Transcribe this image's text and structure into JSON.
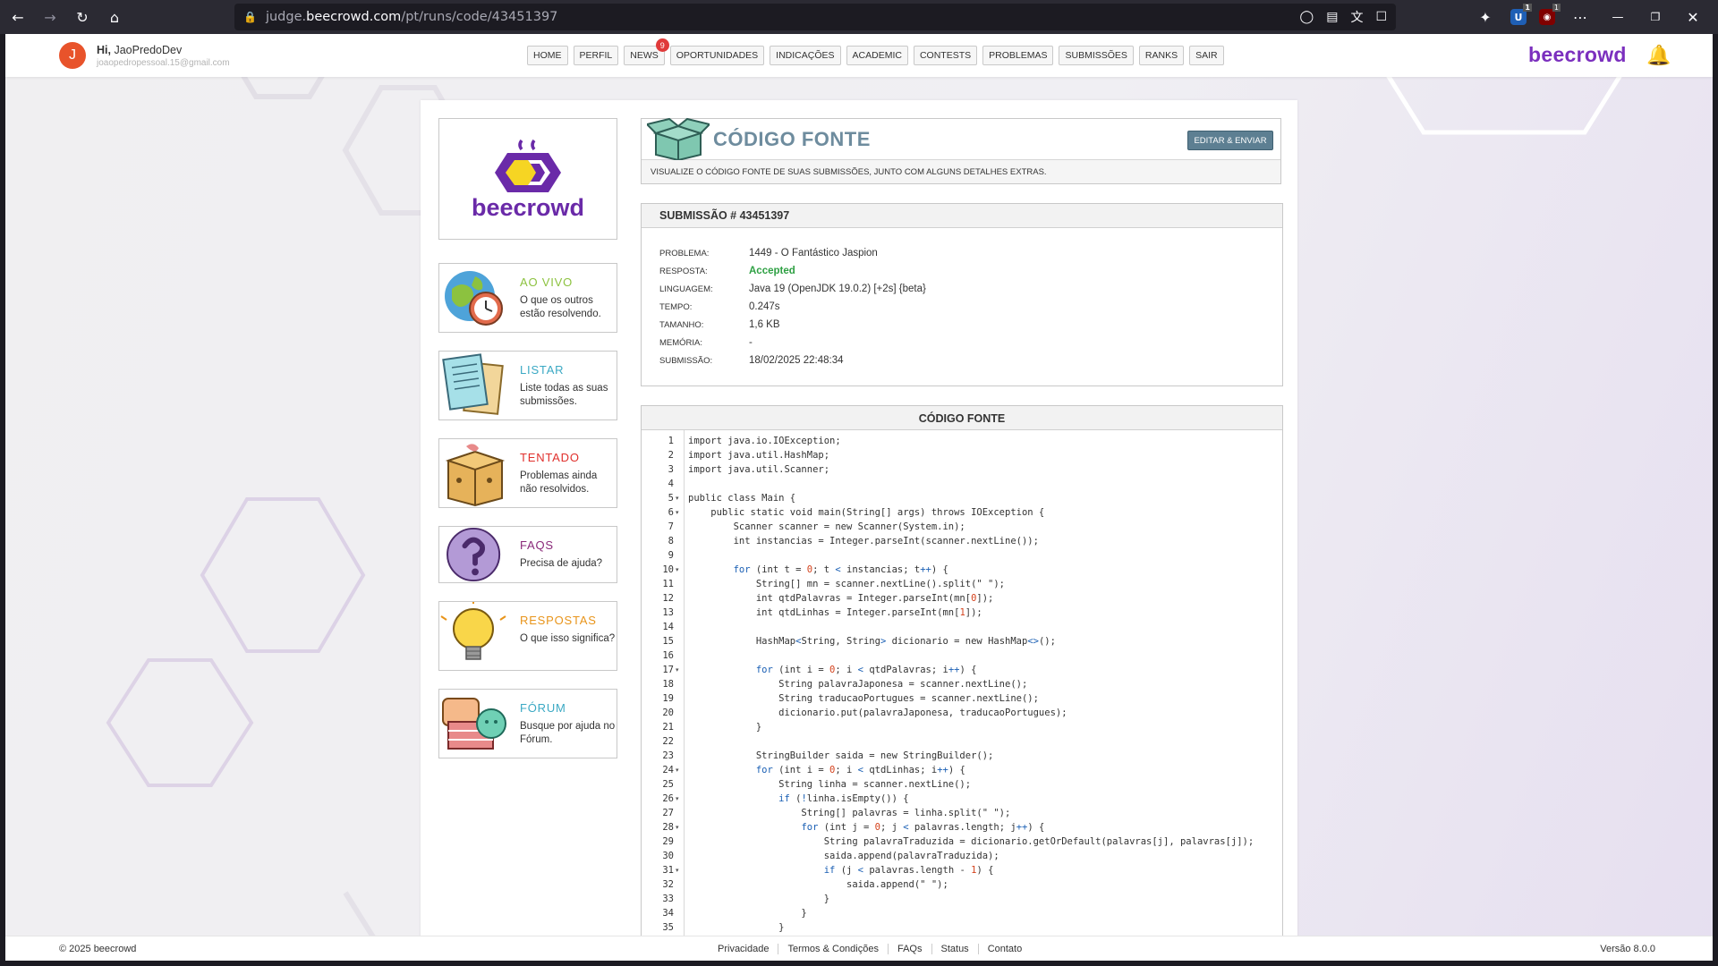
{
  "browser": {
    "url_prefix": "judge.",
    "url_domain": "beecrowd.com",
    "url_path": "/pt/runs/code/43451397",
    "ext_badge_1": "1",
    "ext_badge_2": "1"
  },
  "topbar": {
    "avatar_letter": "J",
    "greeting": "Hi,",
    "username": "JaoPredoDev",
    "email": "joaopedropessoal.15@gmail.com",
    "brand": "beecrowd",
    "menu": [
      {
        "label": "HOME"
      },
      {
        "label": "PERFIL"
      },
      {
        "label": "NEWS",
        "badge": "9"
      },
      {
        "label": "OPORTUNIDADES"
      },
      {
        "label": "INDICAÇÕES"
      },
      {
        "label": "ACADEMIC"
      },
      {
        "label": "CONTESTS"
      },
      {
        "label": "PROBLEMAS"
      },
      {
        "label": "SUBMISSÕES"
      },
      {
        "label": "RANKS"
      },
      {
        "label": "SAIR"
      }
    ]
  },
  "sidebar": {
    "logo_text": "beecrowd",
    "items": [
      {
        "title": "AO VIVO",
        "desc": "O que os outros estão resolvendo.",
        "color": "#8cc23f",
        "icon": "globe-clock-icon"
      },
      {
        "title": "LISTAR",
        "desc": "Liste todas as suas submissões.",
        "color": "#3ba9c4",
        "icon": "list-papers-icon"
      },
      {
        "title": "TENTADO",
        "desc": "Problemas ainda não resolvidos.",
        "color": "#e0302c",
        "icon": "box-icon"
      },
      {
        "title": "FAQS",
        "desc": "Precisa de ajuda?",
        "color": "#8a2a7a",
        "icon": "question-icon"
      },
      {
        "title": "RESPOSTAS",
        "desc": "O que isso significa?",
        "color": "#e8941a",
        "icon": "lightbulb-icon"
      },
      {
        "title": "FÓRUM",
        "desc": "Busque por ajuda no Fórum.",
        "color": "#3ba9c4",
        "icon": "chat-icon"
      }
    ]
  },
  "header": {
    "title": "CÓDIGO FONTE",
    "edit_button": "EDITAR & ENVIAR",
    "subtitle": "VISUALIZE O CÓDIGO FONTE DE SUAS SUBMISSÕES, JUNTO COM ALGUNS DETALHES EXTRAS."
  },
  "submission": {
    "heading": "SUBMISSÃO # 43451397",
    "rows": [
      {
        "key": "PROBLEMA:",
        "value": "1449 - O Fantástico Jaspion"
      },
      {
        "key": "RESPOSTA:",
        "value": "Accepted"
      },
      {
        "key": "LINGUAGEM:",
        "value": "Java 19 (OpenJDK 19.0.2) [+2s] {beta}"
      },
      {
        "key": "TEMPO:",
        "value": "0.247s"
      },
      {
        "key": "TAMANHO:",
        "value": "1,6 KB"
      },
      {
        "key": "MEMÓRIA:",
        "value": "-"
      },
      {
        "key": "SUBMISSÃO:",
        "value": "18/02/2025 22:48:34"
      }
    ]
  },
  "code": {
    "heading": "CÓDIGO FONTE",
    "folds": [
      5,
      6,
      10,
      17,
      24,
      26,
      28,
      31
    ],
    "lines": [
      "import java.io.IOException;",
      "import java.util.HashMap;",
      "import java.util.Scanner;",
      "",
      "public class Main {",
      "    public static void main(String[] args) throws IOException {",
      "        Scanner scanner = new Scanner(System.in);",
      "        int instancias = Integer.parseInt(scanner.nextLine());",
      "",
      "        for (int t = 0; t < instancias; t++) {",
      "            String[] mn = scanner.nextLine().split(\" \");",
      "            int qtdPalavras = Integer.parseInt(mn[0]);",
      "            int qtdLinhas = Integer.parseInt(mn[1]);",
      "",
      "            HashMap<String, String> dicionario = new HashMap<>();",
      "",
      "            for (int i = 0; i < qtdPalavras; i++) {",
      "                String palavraJaponesa = scanner.nextLine();",
      "                String traducaoPortugues = scanner.nextLine();",
      "                dicionario.put(palavraJaponesa, traducaoPortugues);",
      "            }",
      "",
      "            StringBuilder saida = new StringBuilder();",
      "            for (int i = 0; i < qtdLinhas; i++) {",
      "                String linha = scanner.nextLine();",
      "                if (!linha.isEmpty()) {",
      "                    String[] palavras = linha.split(\" \");",
      "                    for (int j = 0; j < palavras.length; j++) {",
      "                        String palavraTraduzida = dicionario.getOrDefault(palavras[j], palavras[j]);",
      "                        saida.append(palavraTraduzida);",
      "                        if (j < palavras.length - 1) {",
      "                            saida.append(\" \");",
      "                        }",
      "                    }",
      "                }"
    ]
  },
  "footer": {
    "copyright": "© 2025 beecrowd",
    "links": [
      "Privacidade",
      "Termos & Condições",
      "FAQs",
      "Status",
      "Contato"
    ],
    "version": "Versão 8.0.0"
  }
}
